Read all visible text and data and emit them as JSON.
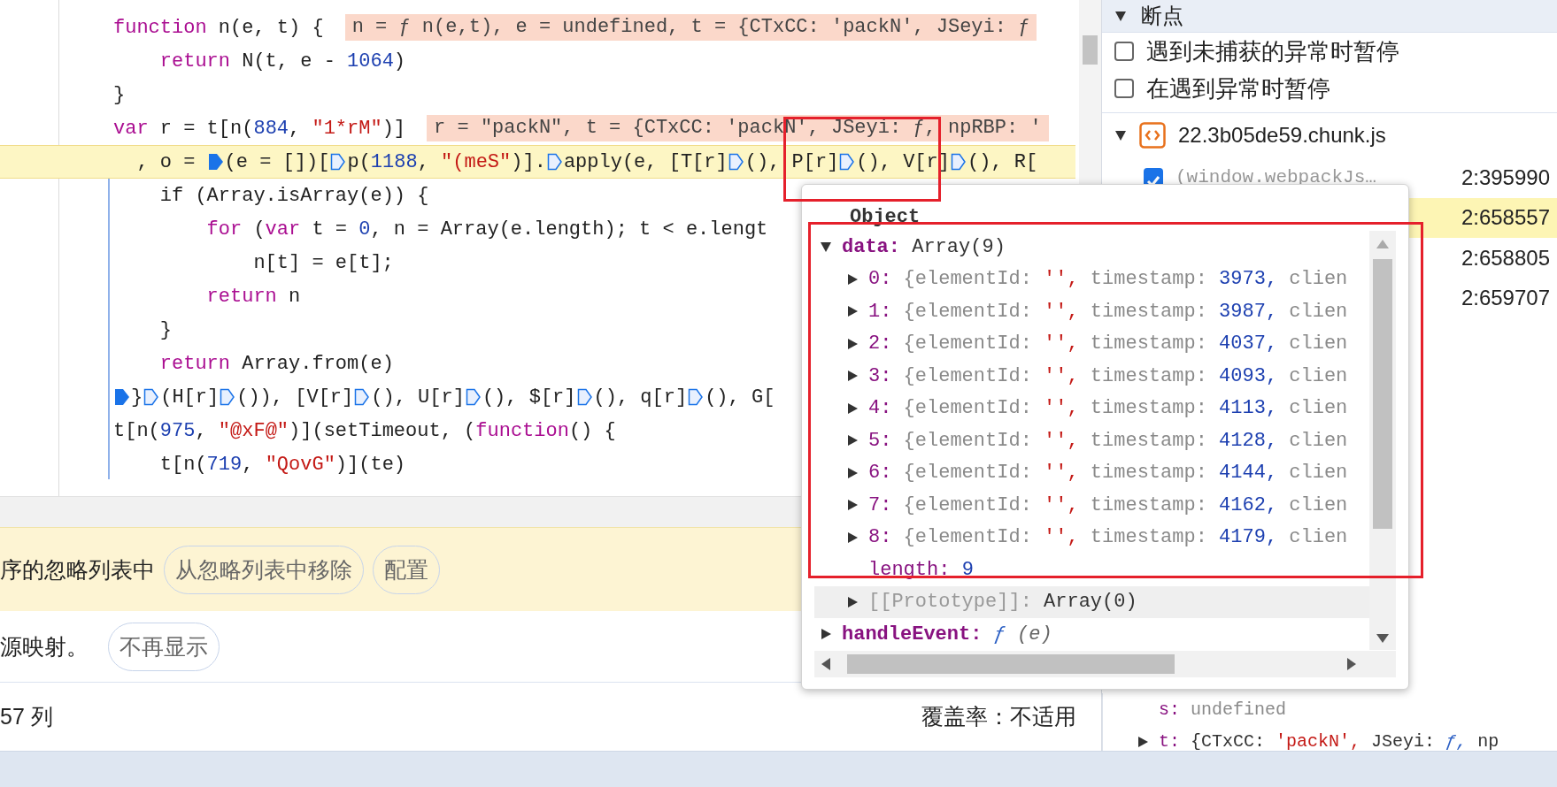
{
  "editor": {
    "lines": [
      {
        "kind": "statement",
        "paused": false,
        "segments": [
          {
            "kind": "code",
            "tokens": [
              {
                "text": "function",
                "kind": "keyword"
              },
              " n(e, t) {"
            ]
          }
        ],
        "inline_value": "n = ƒ n(e,t), e = undefined, t = {CTxCC: 'packN', JSeyi: ƒ",
        "children": [
          {
            "kind": "statement",
            "paused": false,
            "segments": [
              {
                "kind": "code",
                "tokens": [
                  {
                    "text": "return",
                    "kind": "keyword"
                  },
                  " N(t, e - ",
                  {
                    "text": "1064",
                    "kind": "number"
                  },
                  ")"
                ]
              }
            ]
          }
        ]
      },
      {
        "kind": "statement",
        "paused": false,
        "segments": [
          {
            "kind": "code",
            "tokens": [
              "}"
            ]
          }
        ]
      },
      {
        "kind": "statement",
        "paused": false,
        "segments": [
          {
            "kind": "code",
            "tokens": [
              {
                "text": "var",
                "kind": "keyword"
              },
              " r = t[n(",
              {
                "text": "884",
                "kind": "number"
              },
              ", ",
              {
                "text": "\"1*rM\"",
                "kind": "string"
              },
              ")]"
            ]
          }
        ],
        "inline_value": "r = \"packN\", t = {CTxCC: 'packN', JSeyi: ƒ, npRBP: '"
      },
      {
        "kind": "continuation",
        "paused": true,
        "segments": [
          {
            "kind": "code",
            "tokens": [
              ", o = "
            ]
          },
          {
            "kind": "marker",
            "active": true
          },
          {
            "kind": "code",
            "tokens": [
              "(e = [])["
            ]
          },
          {
            "kind": "marker",
            "active": false
          },
          {
            "kind": "code",
            "tokens": [
              "p(",
              {
                "text": "1188",
                "kind": "number"
              },
              ", ",
              {
                "text": "\"(meS\"",
                "kind": "string"
              },
              ")]."
            ]
          },
          {
            "kind": "marker",
            "active": false
          },
          {
            "kind": "code",
            "tokens": [
              "apply(e, [T[r]"
            ]
          },
          {
            "kind": "marker",
            "active": false
          },
          {
            "kind": "code",
            "tokens": [
              "(), P[r]"
            ]
          },
          {
            "kind": "marker",
            "active": false
          },
          {
            "kind": "code",
            "tokens": [
              "(), V[r]"
            ]
          },
          {
            "kind": "marker",
            "active": false
          },
          {
            "kind": "code",
            "tokens": [
              "(), R["
            ]
          }
        ],
        "children": [
          {
            "kind": "statement",
            "paused": false,
            "segments": [
              {
                "kind": "code",
                "tokens": [
                  "if (Array.isArray(e)) {"
                ]
              }
            ],
            "children": [
              {
                "kind": "statement",
                "paused": false,
                "segments": [
                  {
                    "kind": "code",
                    "tokens": [
                      {
                        "text": "for",
                        "kind": "keyword"
                      },
                      " (",
                      {
                        "text": "var",
                        "kind": "keyword"
                      },
                      " t = ",
                      {
                        "text": "0",
                        "kind": "number"
                      },
                      ", n = Array(e.length); t < e.lengt"
                    ]
                  }
                ],
                "children": [
                  {
                    "kind": "statement",
                    "paused": false,
                    "segments": [
                      {
                        "kind": "code",
                        "tokens": [
                          "n[t] = e[t];"
                        ]
                      }
                    ]
                  }
                ]
              },
              {
                "kind": "statement",
                "paused": false,
                "segments": [
                  {
                    "kind": "code",
                    "tokens": [
                      {
                        "text": "return",
                        "kind": "keyword"
                      },
                      " n"
                    ]
                  }
                ]
              }
            ]
          },
          {
            "kind": "statement",
            "paused": false,
            "segments": [
              {
                "kind": "code",
                "tokens": [
                  "}"
                ]
              }
            ]
          },
          {
            "kind": "statement",
            "paused": false,
            "segments": [
              {
                "kind": "code",
                "tokens": [
                  {
                    "text": "return",
                    "kind": "keyword"
                  },
                  " Array.from(e)"
                ]
              }
            ]
          }
        ]
      },
      {
        "kind": "statement",
        "paused": false,
        "segments": [
          {
            "kind": "marker",
            "active": true
          },
          {
            "kind": "code",
            "tokens": [
              "}"
            ]
          },
          {
            "kind": "marker",
            "active": false
          },
          {
            "kind": "code",
            "tokens": [
              "(H[r]"
            ]
          },
          {
            "kind": "marker",
            "active": false
          },
          {
            "kind": "code",
            "tokens": [
              "()), [V[r]"
            ]
          },
          {
            "kind": "marker",
            "active": false
          },
          {
            "kind": "code",
            "tokens": [
              "(), U[r]"
            ]
          },
          {
            "kind": "marker",
            "active": false
          },
          {
            "kind": "code",
            "tokens": [
              "(), $[r]"
            ]
          },
          {
            "kind": "marker",
            "active": false
          },
          {
            "kind": "code",
            "tokens": [
              "(), q[r]"
            ]
          },
          {
            "kind": "marker",
            "active": false
          },
          {
            "kind": "code",
            "tokens": [
              "(), G["
            ]
          }
        ]
      },
      {
        "kind": "statement",
        "paused": false,
        "segments": [
          {
            "kind": "code",
            "tokens": [
              "t[n(",
              {
                "text": "975",
                "kind": "number"
              },
              ", ",
              {
                "text": "\"@xF@\"",
                "kind": "string"
              },
              ")](setTimeout, (",
              {
                "text": "function",
                "kind": "keyword"
              },
              "() {"
            ]
          }
        ],
        "children": [
          {
            "kind": "statement",
            "paused": false,
            "segments": [
              {
                "kind": "code",
                "tokens": [
                  "t[n(",
                  {
                    "text": "719",
                    "kind": "number"
                  },
                  ", ",
                  {
                    "text": "\"QovG\"",
                    "kind": "string"
                  },
                  ")](te)"
                ]
              }
            ]
          }
        ]
      }
    ]
  },
  "ignore_list_bar": {
    "message": "序的忽略列表中",
    "buttons": [
      "从忽略列表中移除",
      "配置"
    ]
  },
  "source_map_bar": {
    "message": "源映射。",
    "buttons": [
      "不再显示"
    ]
  },
  "status_bar": {
    "position": "57 列",
    "coverage": "覆盖率：不适用"
  },
  "breakpoints_panel": {
    "title": "断点",
    "expanded": true,
    "options": [
      {
        "label": "遇到未捕获的异常时暂停",
        "checked": false
      },
      {
        "label": "在遇到异常时暂停",
        "checked": false
      }
    ],
    "files": [
      {
        "name": "22.3b05de59.chunk.js",
        "expanded": true,
        "breakpoints": [
          {
            "code": "(window.webpackJs…",
            "checked": true,
            "location": "2:395990",
            "active": false
          },
          {
            "location": "2:658557",
            "active": true
          },
          {
            "location": "2:658805",
            "active": false
          },
          {
            "location": "2:659707",
            "active": false
          }
        ]
      }
    ]
  },
  "scope": [
    {
      "kind": "field",
      "key": "s:",
      "value": [
        {
          "text": "undefined",
          "kind": "dim"
        }
      ]
    },
    {
      "kind": "entry",
      "expanded": false,
      "key": "t:",
      "value": [
        {
          "text": "{CTxCC:",
          "kind": "plain"
        },
        {
          "text": "'packN',",
          "kind": "string"
        },
        {
          "text": "JSeyi:",
          "kind": "plain"
        },
        {
          "text": "ƒ,",
          "kind": "function"
        },
        {
          "text": "np",
          "kind": "plain"
        }
      ]
    }
  ],
  "popover": {
    "title": "Object",
    "properties": [
      {
        "kind": "object",
        "expanded": true,
        "key": "data:",
        "value": [
          {
            "text": "Array(9)",
            "kind": "plain"
          }
        ],
        "children": [
          {
            "kind": "entry",
            "expanded": false,
            "key": "0:",
            "value": [
              {
                "text": "{elementId:",
                "kind": "dim"
              },
              {
                "text": "'',",
                "kind": "string"
              },
              {
                "text": "timestamp:",
                "kind": "dim"
              },
              {
                "text": "3973,",
                "kind": "number"
              },
              {
                "text": "clien",
                "kind": "dim"
              }
            ]
          },
          {
            "kind": "entry",
            "expanded": false,
            "key": "1:",
            "value": [
              {
                "text": "{elementId:",
                "kind": "dim"
              },
              {
                "text": "'',",
                "kind": "string"
              },
              {
                "text": "timestamp:",
                "kind": "dim"
              },
              {
                "text": "3987,",
                "kind": "number"
              },
              {
                "text": "clien",
                "kind": "dim"
              }
            ]
          },
          {
            "kind": "entry",
            "expanded": false,
            "key": "2:",
            "value": [
              {
                "text": "{elementId:",
                "kind": "dim"
              },
              {
                "text": "'',",
                "kind": "string"
              },
              {
                "text": "timestamp:",
                "kind": "dim"
              },
              {
                "text": "4037,",
                "kind": "number"
              },
              {
                "text": "clien",
                "kind": "dim"
              }
            ]
          },
          {
            "kind": "entry",
            "expanded": false,
            "key": "3:",
            "value": [
              {
                "text": "{elementId:",
                "kind": "dim"
              },
              {
                "text": "'',",
                "kind": "string"
              },
              {
                "text": "timestamp:",
                "kind": "dim"
              },
              {
                "text": "4093,",
                "kind": "number"
              },
              {
                "text": "clien",
                "kind": "dim"
              }
            ]
          },
          {
            "kind": "entry",
            "expanded": false,
            "key": "4:",
            "value": [
              {
                "text": "{elementId:",
                "kind": "dim"
              },
              {
                "text": "'',",
                "kind": "string"
              },
              {
                "text": "timestamp:",
                "kind": "dim"
              },
              {
                "text": "4113,",
                "kind": "number"
              },
              {
                "text": "clien",
                "kind": "dim"
              }
            ]
          },
          {
            "kind": "entry",
            "expanded": false,
            "key": "5:",
            "value": [
              {
                "text": "{elementId:",
                "kind": "dim"
              },
              {
                "text": "'',",
                "kind": "string"
              },
              {
                "text": "timestamp:",
                "kind": "dim"
              },
              {
                "text": "4128,",
                "kind": "number"
              },
              {
                "text": "clien",
                "kind": "dim"
              }
            ]
          },
          {
            "kind": "entry",
            "expanded": false,
            "key": "6:",
            "value": [
              {
                "text": "{elementId:",
                "kind": "dim"
              },
              {
                "text": "'',",
                "kind": "string"
              },
              {
                "text": "timestamp:",
                "kind": "dim"
              },
              {
                "text": "4144,",
                "kind": "number"
              },
              {
                "text": "clien",
                "kind": "dim"
              }
            ]
          },
          {
            "kind": "entry",
            "expanded": false,
            "key": "7:",
            "value": [
              {
                "text": "{elementId:",
                "kind": "dim"
              },
              {
                "text": "'',",
                "kind": "string"
              },
              {
                "text": "timestamp:",
                "kind": "dim"
              },
              {
                "text": "4162,",
                "kind": "number"
              },
              {
                "text": "clien",
                "kind": "dim"
              }
            ]
          },
          {
            "kind": "entry",
            "expanded": false,
            "key": "8:",
            "value": [
              {
                "text": "{elementId:",
                "kind": "dim"
              },
              {
                "text": "'',",
                "kind": "string"
              },
              {
                "text": "timestamp:",
                "kind": "dim"
              },
              {
                "text": "4179,",
                "kind": "number"
              },
              {
                "text": "clien",
                "kind": "dim"
              }
            ]
          },
          {
            "kind": "field",
            "key": "length:",
            "value": [
              {
                "text": "9",
                "kind": "number"
              }
            ]
          },
          {
            "kind": "internal",
            "expanded": false,
            "key": "[[Prototype]]:",
            "value": [
              {
                "text": "Array(0)",
                "kind": "plain"
              }
            ]
          }
        ]
      },
      {
        "kind": "object",
        "expanded": false,
        "key": "handleEvent:",
        "value": [
          {
            "text": "ƒ",
            "kind": "function"
          },
          {
            "text": "(e)",
            "kind": "italic"
          }
        ]
      }
    ]
  },
  "annotations": [
    {
      "kind": "frame"
    },
    {
      "kind": "frame"
    }
  ]
}
